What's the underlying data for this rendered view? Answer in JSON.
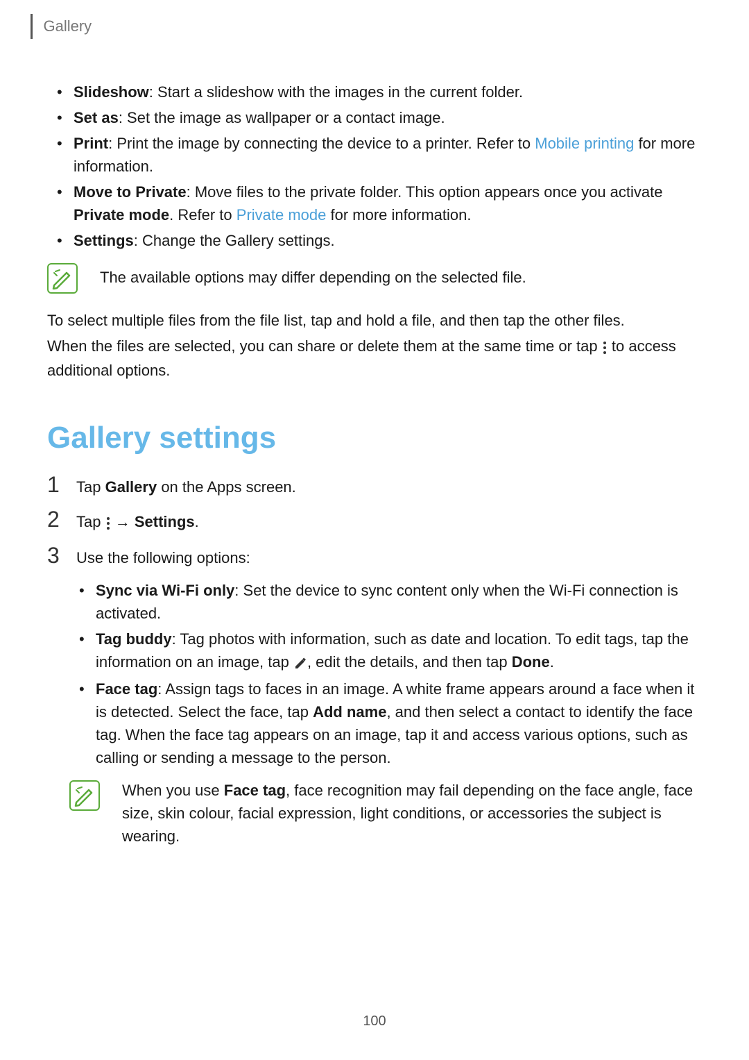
{
  "header": {
    "title": "Gallery"
  },
  "bullets1": {
    "slideshow": {
      "label": "Slideshow",
      "text": ": Start a slideshow with the images in the current folder."
    },
    "setas": {
      "label": "Set as",
      "text": ": Set the image as wallpaper or a contact image."
    },
    "print": {
      "label": "Print",
      "pre": ": Print the image by connecting the device to a printer. Refer to ",
      "link": "Mobile printing",
      "post": " for more information."
    },
    "move": {
      "label": "Move to Private",
      "pre": ": Move files to the private folder. This option appears once you activate ",
      "bold2": "Private mode",
      "mid": ". Refer to ",
      "link": "Private mode",
      "post": " for more information."
    },
    "settings": {
      "label": "Settings",
      "text": ": Change the Gallery settings."
    }
  },
  "note1": "The available options may differ depending on the selected file.",
  "para1": "To select multiple files from the file list, tap and hold a file, and then tap the other files.",
  "para2_pre": "When the files are selected, you can share or delete them at the same time or tap ",
  "para2_post": " to access additional options.",
  "section_heading": "Gallery settings",
  "steps": {
    "s1_pre": "Tap ",
    "s1_bold": "Gallery",
    "s1_post": " on the Apps screen.",
    "s2_pre": "Tap ",
    "s2_arrow": " → ",
    "s2_bold": "Settings",
    "s2_post": ".",
    "s3": "Use the following options:"
  },
  "bullets2": {
    "sync": {
      "label": "Sync via Wi-Fi only",
      "text": ": Set the device to sync content only when the Wi-Fi connection is activated."
    },
    "tagbuddy": {
      "label": "Tag buddy",
      "pre": ": Tag photos with information, such as date and location. To edit tags, tap the information on an image, tap ",
      "mid": ", edit the details, and then tap ",
      "bold2": "Done",
      "post": "."
    },
    "facetag": {
      "label": "Face tag",
      "pre": ": Assign tags to faces in an image. A white frame appears around a face when it is detected. Select the face, tap ",
      "bold2": "Add name",
      "post": ", and then select a contact to identify the face tag. When the face tag appears on an image, tap it and access various options, such as calling or sending a message to the person."
    }
  },
  "note2_pre": "When you use ",
  "note2_bold": "Face tag",
  "note2_post": ", face recognition may fail depending on the face angle, face size, skin colour, facial expression, light conditions, or accessories the subject is wearing.",
  "pagenum": "100"
}
